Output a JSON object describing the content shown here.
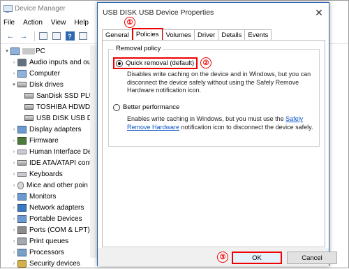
{
  "device_manager": {
    "title": "Device Manager",
    "menu": [
      "File",
      "Action",
      "View",
      "Help"
    ],
    "tree": [
      {
        "label": "PC",
        "level": 0,
        "arrow": "▾",
        "icon": "computer-icon",
        "blurred_prefix": true
      },
      {
        "label": "Audio inputs and ou",
        "level": 1,
        "arrow": "›",
        "icon": "audio-icon"
      },
      {
        "label": "Computer",
        "level": 1,
        "arrow": "›",
        "icon": "computer-icon"
      },
      {
        "label": "Disk drives",
        "level": 1,
        "arrow": "▾",
        "icon": "disk-icon"
      },
      {
        "label": "SanDisk SSD PLU",
        "level": 2,
        "arrow": "",
        "icon": "disk-icon"
      },
      {
        "label": "TOSHIBA HDWD",
        "level": 2,
        "arrow": "",
        "icon": "disk-icon"
      },
      {
        "label": "USB DISK USB D",
        "level": 2,
        "arrow": "",
        "icon": "disk-icon"
      },
      {
        "label": "Display adapters",
        "level": 1,
        "arrow": "›",
        "icon": "monitor-icon"
      },
      {
        "label": "Firmware",
        "level": 1,
        "arrow": "›",
        "icon": "chip-icon"
      },
      {
        "label": "Human Interface Dev",
        "level": 1,
        "arrow": "›",
        "icon": "hid-icon"
      },
      {
        "label": "IDE ATA/ATAPI contr",
        "level": 1,
        "arrow": "›",
        "icon": "ide-icon"
      },
      {
        "label": "Keyboards",
        "level": 1,
        "arrow": "›",
        "icon": "keyboard-icon"
      },
      {
        "label": "Mice and other poin",
        "level": 1,
        "arrow": "›",
        "icon": "mouse-icon"
      },
      {
        "label": "Monitors",
        "level": 1,
        "arrow": "›",
        "icon": "monitor-icon"
      },
      {
        "label": "Network adapters",
        "level": 1,
        "arrow": "›",
        "icon": "network-icon"
      },
      {
        "label": "Portable Devices",
        "level": 1,
        "arrow": "›",
        "icon": "portable-device-icon"
      },
      {
        "label": "Ports (COM & LPT)",
        "level": 1,
        "arrow": "›",
        "icon": "port-icon"
      },
      {
        "label": "Print queues",
        "level": 1,
        "arrow": "›",
        "icon": "printer-icon"
      },
      {
        "label": "Processors",
        "level": 1,
        "arrow": "›",
        "icon": "processor-icon"
      },
      {
        "label": "Security devices",
        "level": 1,
        "arrow": "›",
        "icon": "security-icon"
      }
    ]
  },
  "dialog": {
    "title": "USB DISK USB Device Properties",
    "close_glyph": "✕",
    "tabs": [
      "General",
      "Policies",
      "Volumes",
      "Driver",
      "Details",
      "Events"
    ],
    "active_tab": "Policies",
    "group_title": "Removal policy",
    "quick": {
      "label": "Quick removal (default)",
      "selected": true,
      "desc": "Disables write caching on the device and in Windows, but you can disconnect the device safely without using the Safely Remove Hardware notification icon."
    },
    "better": {
      "label": "Better performance",
      "selected": false,
      "desc_before": "Enables write caching in Windows, but you must use the",
      "link": "Safely Remove Hardware",
      "desc_after": "notification icon to disconnect the device safely."
    },
    "ok_label": "OK",
    "cancel_label": "Cancel"
  },
  "markers": [
    "①",
    "②",
    "③"
  ],
  "colors": {
    "highlight": "#e00000",
    "link": "#0b57c8",
    "dialog_border": "#1f5fa8"
  }
}
